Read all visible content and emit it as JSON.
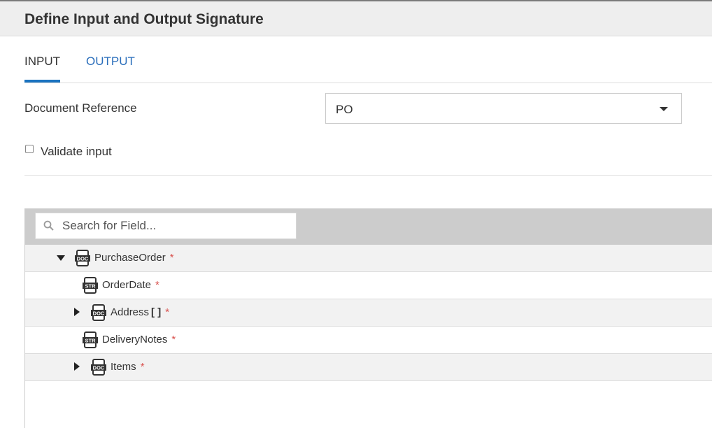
{
  "header": {
    "title": "Define Input and Output Signature"
  },
  "tabs": [
    {
      "label": "INPUT",
      "active": true
    },
    {
      "label": "OUTPUT",
      "active": false
    }
  ],
  "document_reference": {
    "label": "Document Reference",
    "value": "PO"
  },
  "validate": {
    "label": "Validate input",
    "checked": false
  },
  "search": {
    "placeholder": "Search for Field..."
  },
  "tree": [
    {
      "name": "PurchaseOrder",
      "type": "DOC",
      "expanded": true,
      "array": "",
      "required": "*"
    },
    {
      "name": "OrderDate",
      "type": "STR",
      "array": "",
      "required": "*"
    },
    {
      "name": "Address",
      "type": "DOC",
      "expanded": false,
      "array": "[ ]",
      "required": "*"
    },
    {
      "name": "DeliveryNotes",
      "type": "STR",
      "array": "",
      "required": "*"
    },
    {
      "name": "Items",
      "type": "DOC",
      "expanded": false,
      "array": "",
      "required": "*"
    }
  ],
  "colors": {
    "accent": "#1a73c0",
    "link": "#2a6ebb",
    "required": "#d9534f",
    "toolbar": "#cccccc"
  }
}
